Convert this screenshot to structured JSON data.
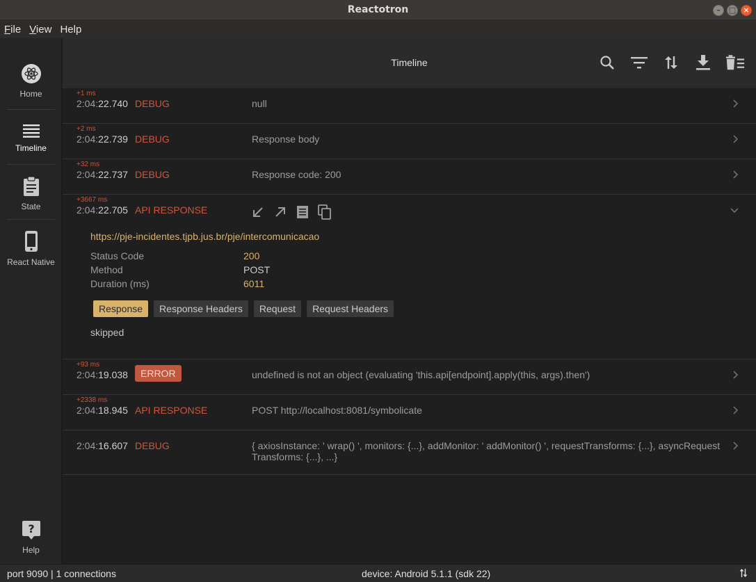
{
  "window": {
    "title": "Reactotron"
  },
  "menubar": [
    {
      "label": "File",
      "mnemonic": "F",
      "rest": "ile"
    },
    {
      "label": "View",
      "mnemonic": "V",
      "rest": "iew"
    },
    {
      "label": "Help",
      "mnemonic": "",
      "rest": "Help"
    }
  ],
  "sidebar": {
    "items": [
      {
        "label": "Home",
        "icon": "atom-icon"
      },
      {
        "label": "Timeline",
        "icon": "list-icon"
      },
      {
        "label": "State",
        "icon": "clipboard-icon"
      },
      {
        "label": "React Native",
        "icon": "phone-icon"
      }
    ],
    "help": {
      "label": "Help",
      "icon": "help-icon"
    }
  },
  "header": {
    "title": "Timeline",
    "icons": [
      "search-icon",
      "filter-icon",
      "sort-icon",
      "download-icon",
      "delete-all-icon"
    ]
  },
  "timeline": [
    {
      "delta": "+1 ms",
      "time_prefix": "2:04:",
      "time_main": "22.740",
      "kind": "DEBUG",
      "message": "null"
    },
    {
      "delta": "+2 ms",
      "time_prefix": "2:04:",
      "time_main": "22.739",
      "kind": "DEBUG",
      "message": "Response body"
    },
    {
      "delta": "+32 ms",
      "time_prefix": "2:04:",
      "time_main": "22.737",
      "kind": "DEBUG",
      "message": "Response code: 200"
    },
    {
      "delta": "+3667 ms",
      "time_prefix": "2:04:",
      "time_main": "22.705",
      "kind": "API RESPONSE",
      "expanded": true,
      "detail": {
        "url": "https://pje-incidentes.tjpb.jus.br/pje/intercomunicacao",
        "fields": [
          {
            "key": "Status Code",
            "value": "200",
            "accent": true
          },
          {
            "key": "Method",
            "value": "POST",
            "accent": false
          },
          {
            "key": "Duration (ms)",
            "value": "6011",
            "accent": true
          }
        ],
        "tabs": [
          "Response",
          "Response Headers",
          "Request",
          "Request Headers"
        ],
        "active_tab": "Response",
        "body": "skipped"
      }
    },
    {
      "delta": "+93 ms",
      "time_prefix": "2:04:",
      "time_main": "19.038",
      "kind": "ERROR",
      "message": "undefined is not an object (evaluating 'this.api[endpoint].apply(this, args).then')"
    },
    {
      "delta": "+2338 ms",
      "time_prefix": "2:04:",
      "time_main": "18.945",
      "kind": "API RESPONSE",
      "message": "POST http://localhost:8081/symbolicate"
    },
    {
      "delta": "",
      "time_prefix": "2:04:",
      "time_main": "16.607",
      "kind": "DEBUG",
      "message": "{ axiosInstance: ' wrap() ', monitors: {...}, addMonitor: ' addMonitor() ', requestTransforms: {...}, asyncRequestTransforms: {...}, ...}"
    }
  ],
  "status": {
    "left": "port 9090 | 1 connections",
    "middle": "device: Android 5.1.1 (sdk 22)"
  },
  "colors": {
    "accent_red": "#d0553d",
    "accent_gold": "#d9b36c",
    "bg": "#1f1f1f"
  }
}
